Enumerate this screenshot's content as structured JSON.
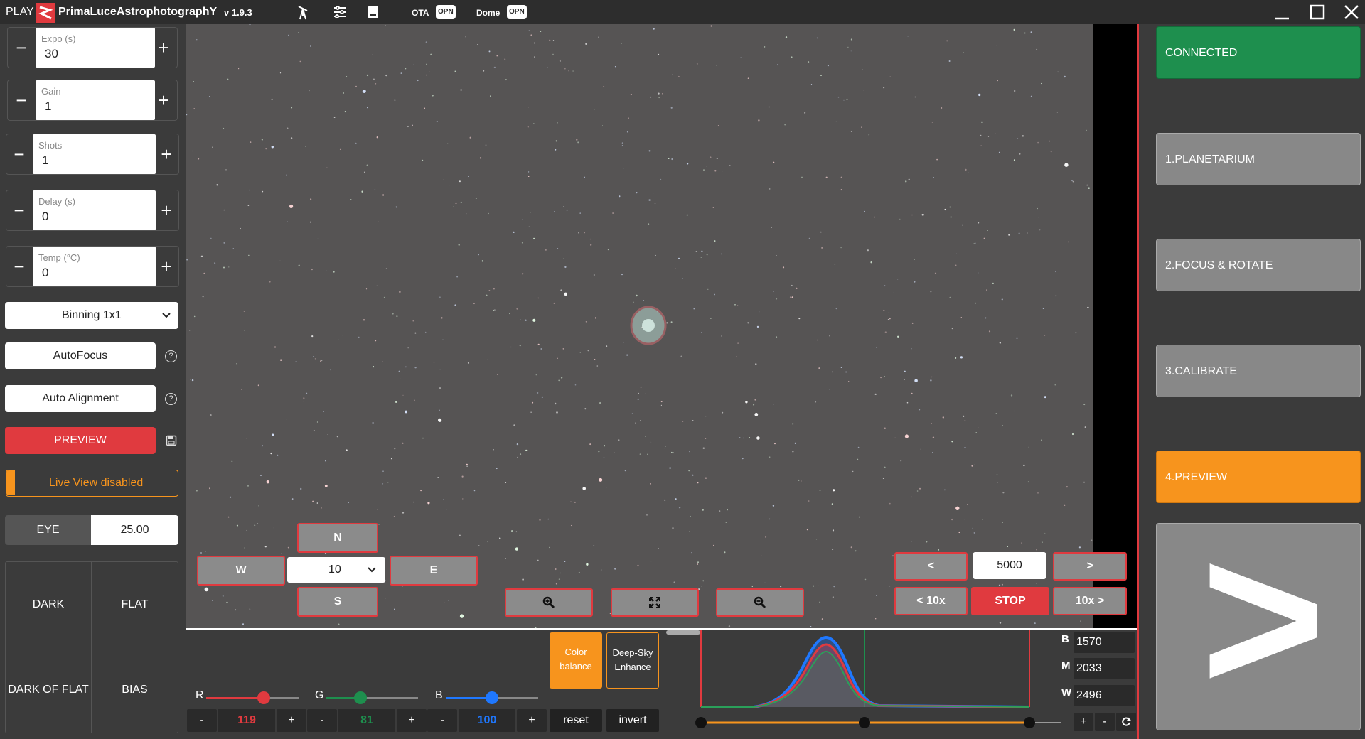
{
  "titlebar": {
    "play": "PLAY",
    "brand": "PrimaLuceAstrophotographY",
    "version": "v 1.9.3",
    "ota_label": "OTA",
    "ota_badge": "OPN",
    "dome_label": "Dome",
    "dome_badge": "OPN",
    "icons": [
      "telescope-icon",
      "sliders-icon",
      "book-icon",
      "minimize-icon",
      "maximize-icon",
      "close-icon"
    ]
  },
  "left": {
    "expo": {
      "label": "Expo (s)",
      "value": "30",
      "minus": "−",
      "plus": "+"
    },
    "gain": {
      "label": "Gain",
      "value": "1",
      "minus": "−",
      "plus": "+"
    },
    "shots": {
      "label": "Shots",
      "value": "1",
      "minus": "−",
      "plus": "+"
    },
    "delay": {
      "label": "Delay (s)",
      "value": "0",
      "minus": "−",
      "plus": "+"
    },
    "temp": {
      "label": "Temp (°C)",
      "value": "0",
      "minus": "−",
      "plus": "+"
    },
    "binning": "Binning 1x1",
    "autofocus": "AutoFocus",
    "auto_alignment": "Auto Alignment",
    "help": "?",
    "preview": "PREVIEW",
    "live_view": "Live View disabled",
    "eye_label": "EYE",
    "eye_value": "25.00",
    "dark": "DARK",
    "flat": "FLAT",
    "dark_of_flat": "DARK OF FLAT",
    "bias": "BIAS"
  },
  "nav": {
    "north": "N",
    "south": "S",
    "west": "W",
    "east": "E",
    "step": "10",
    "prev": "<",
    "next": ">",
    "prev10": "< 10x",
    "next10": "10x >",
    "stop": "STOP",
    "position": "5000"
  },
  "bottom": {
    "r_label": "R",
    "g_label": "G",
    "b_label": "B",
    "r_value": "119",
    "g_value": "81",
    "b_value": "100",
    "r_level": 0.62,
    "g_level": 0.38,
    "b_level": 0.5,
    "minus": "-",
    "plus": "+",
    "reset": "reset",
    "invert": "invert",
    "color_balance": "Color balance",
    "deep_sky": "Deep-Sky Enhance",
    "b": "B",
    "m": "M",
    "w": "W",
    "b_val": "1570",
    "m_val": "2033",
    "w_val": "2496",
    "hist_plus": "+",
    "hist_minus": "-"
  },
  "right": {
    "connected": "CONNECTED",
    "step1": "1.PLANETARIUM",
    "step2": "2.FOCUS & ROTATE",
    "step3": "3.CALIBRATE",
    "step4": "4.PREVIEW",
    "next_glyph": ">"
  },
  "colors": {
    "red": "#e03a3f",
    "green": "#1e8f4e",
    "orange": "#f7941d",
    "blue": "#1f78ff"
  }
}
